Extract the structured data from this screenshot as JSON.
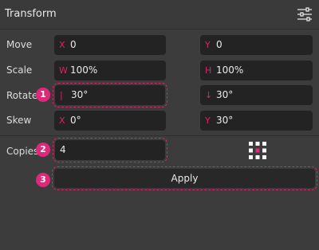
{
  "header": {
    "title": "Transform",
    "settings_icon": "sliders-icon"
  },
  "rows": {
    "move": {
      "label": "Move",
      "left": {
        "prefix": "X",
        "value": "0"
      },
      "right": {
        "prefix": "Y",
        "value": "0"
      }
    },
    "scale": {
      "label": "Scale",
      "left": {
        "prefix": "W",
        "value": "100%"
      },
      "right": {
        "prefix": "H",
        "value": "100%"
      }
    },
    "rotate": {
      "label": "Rotate",
      "left": {
        "prefix": "|",
        "value": "30°"
      },
      "right": {
        "prefix": "↓",
        "value": "30°"
      }
    },
    "skew": {
      "label": "Skew",
      "left": {
        "prefix": "X",
        "value": "0°"
      },
      "right": {
        "prefix": "Y",
        "value": "30°"
      }
    }
  },
  "copies": {
    "label": "Copies",
    "value": "4",
    "anchor_icon": "anchor-grid-icon"
  },
  "apply": {
    "label": "Apply"
  },
  "callouts": [
    "1",
    "2",
    "3"
  ],
  "colors": {
    "accent": "#e0287a",
    "panel": "#3c3c3c",
    "field": "#232323"
  }
}
